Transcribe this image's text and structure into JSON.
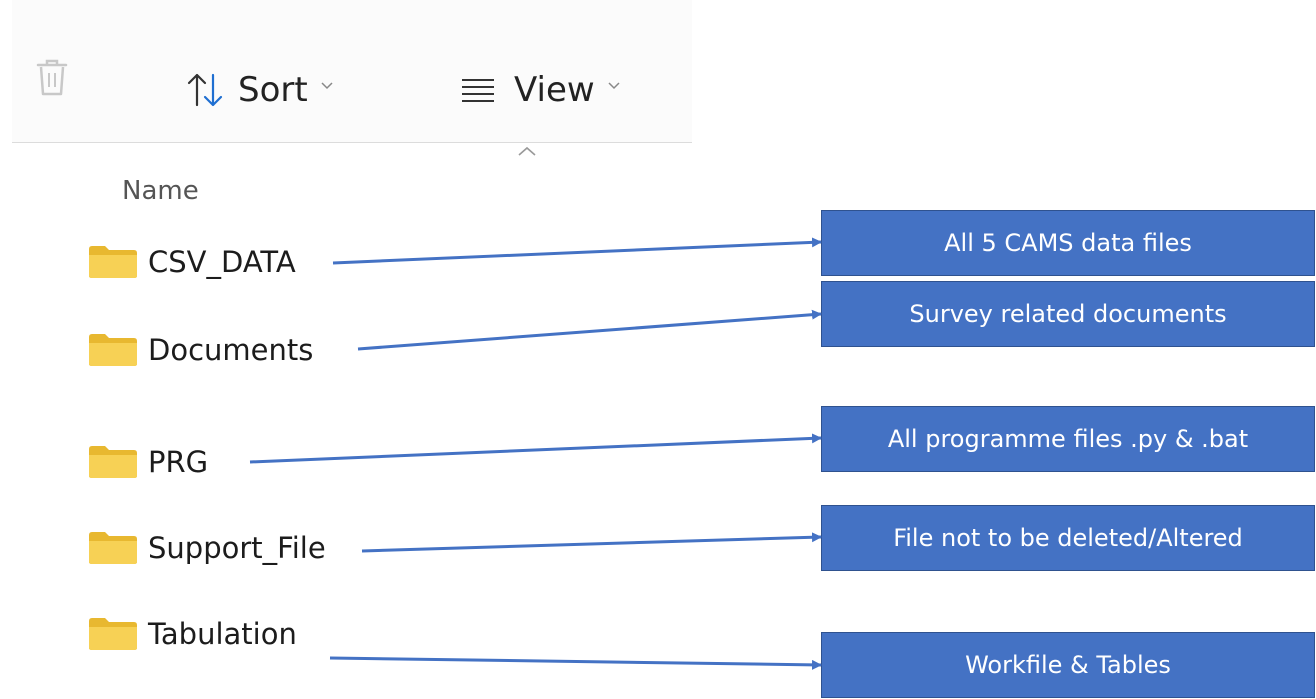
{
  "toolbar": {
    "delete_icon": "trash-icon",
    "sort_label": "Sort",
    "view_label": "View"
  },
  "file_list": {
    "column_name": "Name",
    "items": [
      {
        "name": "CSV_DATA",
        "icon": "folder-icon"
      },
      {
        "name": "Documents",
        "icon": "folder-icon"
      },
      {
        "name": "PRG",
        "icon": "folder-icon"
      },
      {
        "name": "Support_File",
        "icon": "folder-icon"
      },
      {
        "name": "Tabulation",
        "icon": "folder-icon"
      }
    ]
  },
  "annotations": [
    {
      "text": "All 5 CAMS data files"
    },
    {
      "text": "Survey related documents"
    },
    {
      "text": "All programme files .py & .bat"
    },
    {
      "text": "File not to be deleted/Altered"
    },
    {
      "text": "Workfile & Tables"
    }
  ],
  "colors": {
    "annotation_fill": "#4472c4",
    "arrow": "#4472c4",
    "folder": "#f2c94c"
  }
}
